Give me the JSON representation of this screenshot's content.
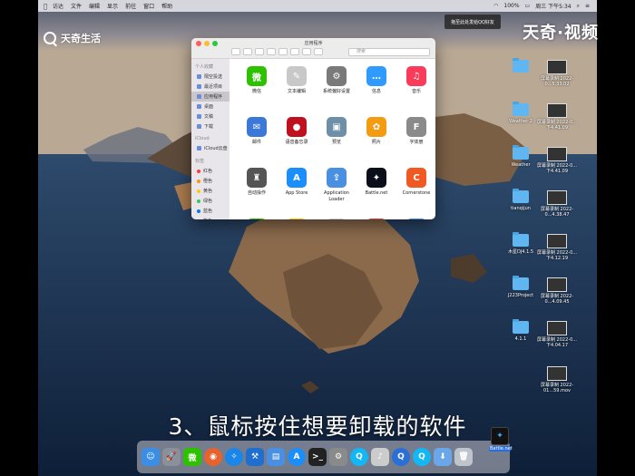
{
  "brand": {
    "left_name": "天奇生活",
    "right_name": "天奇·视频"
  },
  "menubar": {
    "apple": "",
    "items": [
      "访达",
      "文件",
      "编辑",
      "显示",
      "前往",
      "窗口",
      "帮助"
    ],
    "battery": "100%",
    "clock": "周三 下午5:34"
  },
  "notice": {
    "text": "拖至此处发给QQ好友"
  },
  "finder": {
    "title": "应用程序",
    "search_placeholder": "搜索",
    "sidebar": {
      "favorites_head": "个人收藏",
      "favorites": [
        "隔空投送",
        "最近项目",
        "应用程序",
        "桌面",
        "文稿",
        "下载"
      ],
      "icloud_head": "iCloud",
      "icloud": [
        "iCloud云盘"
      ],
      "tags_head": "标签",
      "tags": [
        {
          "label": "红色",
          "color": "#ff3b30"
        },
        {
          "label": "橙色",
          "color": "#ff9500"
        },
        {
          "label": "黄色",
          "color": "#ffcc00"
        },
        {
          "label": "绿色",
          "color": "#34c759"
        },
        {
          "label": "蓝色",
          "color": "#007aff"
        },
        {
          "label": "紫色",
          "color": "#af52de"
        }
      ]
    },
    "apps": [
      {
        "label": "微信",
        "glyph": "微",
        "color": "#2dc100"
      },
      {
        "label": "文本编辑",
        "glyph": "✎",
        "color": "#c8c8c8"
      },
      {
        "label": "系统偏好设置",
        "glyph": "⚙",
        "color": "#7a7a7a"
      },
      {
        "label": "信息",
        "glyph": "…",
        "color": "#2f9bff"
      },
      {
        "label": "音乐",
        "glyph": "♫",
        "color": "#fa3c5a"
      },
      {
        "label": "邮件",
        "glyph": "✉",
        "color": "#3b78d8"
      },
      {
        "label": "语音备忘录",
        "glyph": "●",
        "color": "#c0101f"
      },
      {
        "label": "预览",
        "glyph": "▣",
        "color": "#6d8fa8"
      },
      {
        "label": "照片",
        "glyph": "✿",
        "color": "#f39c12"
      },
      {
        "label": "字体册",
        "glyph": "F",
        "color": "#8a8a8a"
      },
      {
        "label": "自动操作",
        "glyph": "♜",
        "color": "#555555"
      },
      {
        "label": "App Store",
        "glyph": "A",
        "color": "#1c8ef9"
      },
      {
        "label": "Application Loader",
        "glyph": "⇪",
        "color": "#4a90e2"
      },
      {
        "label": "Battle.net",
        "glyph": "✦",
        "color": "#0b0f1a"
      },
      {
        "label": "Cornerstone",
        "glyph": "C",
        "color": "#f05a22"
      }
    ]
  },
  "desktop": [
    {
      "label": "",
      "type": "folder"
    },
    {
      "label": "屏幕录制 2022-0...5.33.02",
      "type": "shot"
    },
    {
      "label": "Weather 2",
      "type": "folder"
    },
    {
      "label": "屏幕录制 2022-0...下4.41.09",
      "type": "shot"
    },
    {
      "label": "Weather",
      "type": "folder"
    },
    {
      "label": "屏幕录制 2022-0...下4.41.09",
      "type": "shot"
    },
    {
      "label": "tianqijun",
      "type": "folder"
    },
    {
      "label": "屏幕录制 2022-0...4.38.47",
      "type": "shot"
    },
    {
      "label": "木星DJ4.1.5",
      "type": "folder"
    },
    {
      "label": "屏幕录制 2022-0...下4.12.19",
      "type": "shot"
    },
    {
      "label": "J223Project",
      "type": "folder"
    },
    {
      "label": "屏幕录制 2022-0...4.09.45",
      "type": "shot"
    },
    {
      "label": "4.1.1",
      "type": "folder"
    },
    {
      "label": "屏幕录制 2022-0...下4.04.17",
      "type": "shot"
    },
    {
      "label": "屏幕录制 2022-01...59.mov",
      "type": "shot"
    }
  ],
  "dock": [
    {
      "name": "finder",
      "glyph": "☺",
      "color": "#3a8ee6"
    },
    {
      "name": "launchpad",
      "glyph": "🚀",
      "color": "#8a8f99"
    },
    {
      "name": "wechat",
      "glyph": "微",
      "color": "#2dc100"
    },
    {
      "name": "firefox",
      "glyph": "◉",
      "color": "#e8622c"
    },
    {
      "name": "safari",
      "glyph": "✧",
      "color": "#1a86e8"
    },
    {
      "name": "xcode",
      "glyph": "⚒",
      "color": "#1f6fd0"
    },
    {
      "name": "files",
      "glyph": "▤",
      "color": "#4a90e2"
    },
    {
      "name": "app-store",
      "glyph": "A",
      "color": "#1c8ef9"
    },
    {
      "name": "terminal",
      "glyph": ">_",
      "color": "#222222"
    },
    {
      "name": "system-preferences",
      "glyph": "⚙",
      "color": "#8a8a8a"
    },
    {
      "name": "qq",
      "glyph": "Q",
      "color": "#12b7f5"
    },
    {
      "name": "mic",
      "glyph": "♪",
      "color": "#cccccc"
    },
    {
      "name": "quicktime",
      "glyph": "Q",
      "color": "#2a6fd6"
    },
    {
      "name": "qq-2",
      "glyph": "Q",
      "color": "#12b7f5"
    },
    {
      "name": "downloads",
      "glyph": "⬇",
      "color": "#6aa6e8"
    },
    {
      "name": "trash",
      "glyph": "🗑",
      "color": "#bfc4cc"
    }
  ],
  "dragged": {
    "label": "Battle.net"
  },
  "subtitle": "3、鼠标按住想要卸载的软件"
}
